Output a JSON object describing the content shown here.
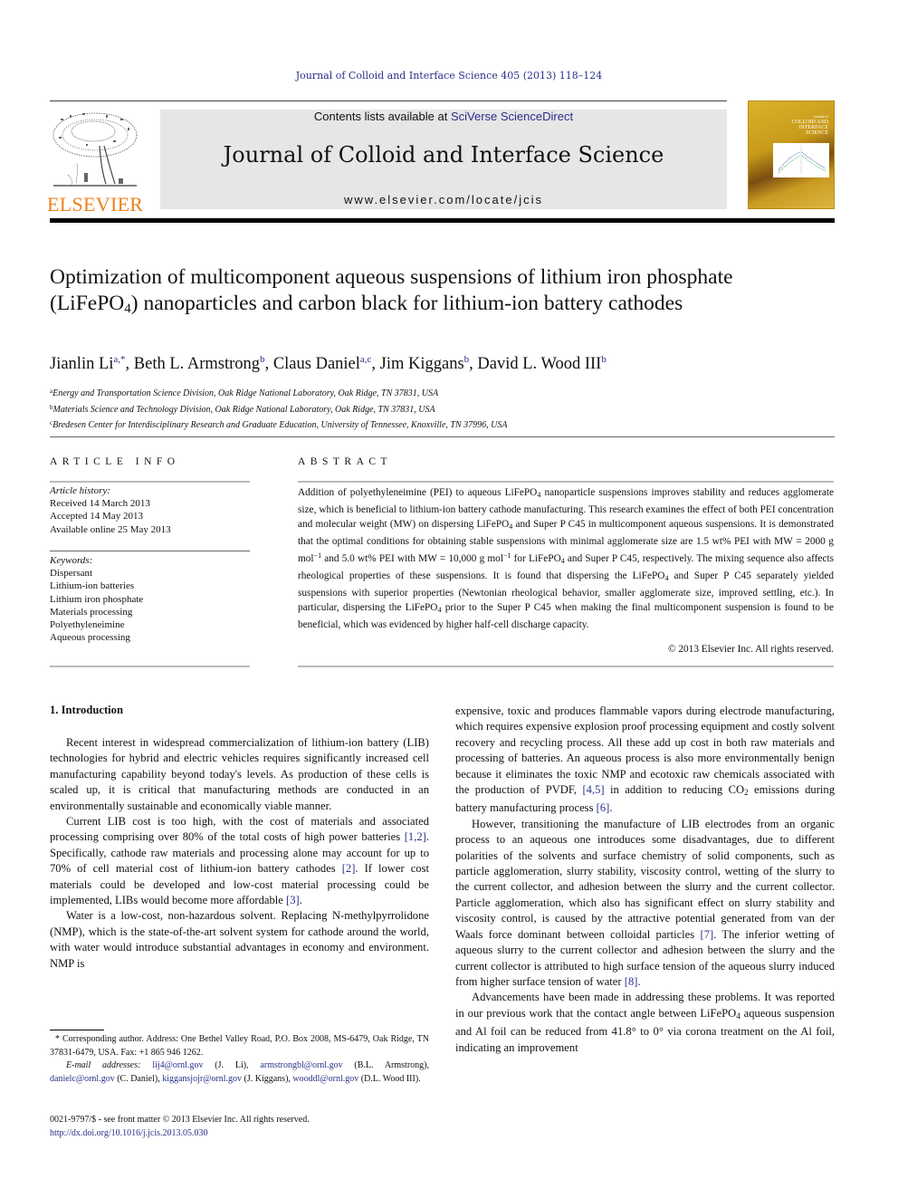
{
  "running_head": "Journal of Colloid and Interface Science 405 (2013) 118–124",
  "publisher": {
    "logo_word": "ELSEVIER",
    "contents_prefix": "Contents lists available at ",
    "contents_link": "SciVerse ScienceDirect",
    "journal_name": "Journal of Colloid and Interface Science",
    "journal_url": "www.elsevier.com/locate/jcis",
    "cover_title_lines": [
      "Journal of",
      "COLLOID AND",
      "INTERFACE",
      "SCIENCE"
    ]
  },
  "colors": {
    "link": "#2a2f8a",
    "elsevier_orange": "#f07f1a",
    "banner_gray": "#e6e6e6",
    "cover_gold": "#c89a1a"
  },
  "article": {
    "title_parts": {
      "before_sub": "Optimization of multicomponent aqueous suspensions of lithium iron phosphate (LiFePO",
      "sub": "4",
      "after_sub": ") nanoparticles and carbon black for lithium-ion battery cathodes"
    },
    "authors": [
      {
        "name": "Jianlin Li",
        "sup": "a,*",
        "sep": ", "
      },
      {
        "name": "Beth L. Armstrong",
        "sup": "b",
        "sep": ", "
      },
      {
        "name": "Claus Daniel",
        "sup": "a,c",
        "sep": ", "
      },
      {
        "name": "Jim Kiggans",
        "sup": "b",
        "sep": ", "
      },
      {
        "name": "David L. Wood III",
        "sup": "b",
        "sep": ""
      }
    ],
    "affiliations": [
      {
        "mark": "a",
        "text": "Energy and Transportation Science Division, Oak Ridge National Laboratory, Oak Ridge, TN 37831, USA"
      },
      {
        "mark": "b",
        "text": "Materials Science and Technology Division, Oak Ridge National Laboratory, Oak Ridge, TN 37831, USA"
      },
      {
        "mark": "c",
        "text": "Bredesen Center for Interdisciplinary Research and Graduate Education, University of Tennessee, Knoxville, TN 37996, USA"
      }
    ]
  },
  "article_info": {
    "heading": "ARTICLE INFO",
    "history_label": "Article history:",
    "history": [
      "Received 14 March 2013",
      "Accepted 14 May 2013",
      "Available online 25 May 2013"
    ],
    "keywords_label": "Keywords:",
    "keywords": [
      "Dispersant",
      "Lithium-ion batteries",
      "Lithium iron phosphate",
      "Materials processing",
      "Polyethyleneimine",
      "Aqueous processing"
    ]
  },
  "abstract": {
    "heading": "ABSTRACT",
    "segments": [
      {
        "t": "Addition of polyethyleneimine (PEI) to aqueous LiFePO"
      },
      {
        "sub": "4"
      },
      {
        "t": " nanoparticle suspensions improves stability and reduces agglomerate size, which is beneficial to lithium-ion battery cathode manufacturing. This research examines the effect of both PEI concentration and molecular weight (MW) on dispersing LiFePO"
      },
      {
        "sub": "4"
      },
      {
        "t": " and Super P C45 in multicomponent aqueous suspensions. It is demonstrated that the optimal conditions for obtaining stable suspensions with minimal agglomerate size are 1.5 wt% PEI with MW = 2000 g mol"
      },
      {
        "sup": "−1"
      },
      {
        "t": " and 5.0 wt% PEI with MW = 10,000 g mol"
      },
      {
        "sup": "−1"
      },
      {
        "t": " for LiFePO"
      },
      {
        "sub": "4"
      },
      {
        "t": " and Super P C45, respectively. The mixing sequence also affects rheological properties of these suspensions. It is found that dispersing the LiFePO"
      },
      {
        "sub": "4"
      },
      {
        "t": " and Super P C45 separately yielded suspensions with superior properties (Newtonian rheological behavior, smaller agglomerate size, improved settling, etc.). In particular, dispersing the LiFePO"
      },
      {
        "sub": "4"
      },
      {
        "t": " prior to the Super P C45 when making the final multicomponent suspension is found to be beneficial, which was evidenced by higher half-cell discharge capacity."
      }
    ],
    "copyright": "© 2013 Elsevier Inc. All rights reserved."
  },
  "body": {
    "section_heading": "1. Introduction",
    "left_paragraphs": [
      [
        {
          "t": "Recent interest in widespread commercialization of lithium-ion battery (LIB) technologies for hybrid and electric vehicles requires significantly increased cell manufacturing capability beyond today's levels. As production of these cells is scaled up, it is critical that manufacturing methods are conducted in an environmentally sustainable and economically viable manner."
        }
      ],
      [
        {
          "t": "Current LIB cost is too high, with the cost of materials and associated processing comprising over 80% of the total costs of high power batteries "
        },
        {
          "ref": "[1,2]"
        },
        {
          "t": ". Specifically, cathode raw materials and processing alone may account for up to 70% of cell material cost of lithium-ion battery cathodes "
        },
        {
          "ref": "[2]"
        },
        {
          "t": ". If lower cost materials could be developed and low-cost material processing could be implemented, LIBs would become more affordable "
        },
        {
          "ref": "[3]"
        },
        {
          "t": "."
        }
      ],
      [
        {
          "t": "Water is a low-cost, non-hazardous solvent. Replacing N-methylpyrrolidone (NMP), which is the state-of-the-art solvent system for cathode around the world, with water would introduce substantial advantages in economy and environment. NMP is"
        }
      ]
    ],
    "right_paragraphs": [
      {
        "indent": false,
        "segs": [
          {
            "t": "expensive, toxic and produces flammable vapors during electrode manufacturing, which requires expensive explosion proof processing equipment and costly solvent recovery and recycling process. All these add up cost in both raw materials and processing of batteries. An aqueous process is also more environmentally benign because it eliminates the toxic NMP and ecotoxic raw chemicals associated with the production of PVDF, "
          },
          {
            "ref": "[4,5]"
          },
          {
            "t": " in addition to reducing CO"
          },
          {
            "sub": "2"
          },
          {
            "t": " emissions during battery manufacturing process "
          },
          {
            "ref": "[6]"
          },
          {
            "t": "."
          }
        ]
      },
      {
        "indent": true,
        "segs": [
          {
            "t": "However, transitioning the manufacture of LIB electrodes from an organic process to an aqueous one introduces some disadvantages, due to different polarities of the solvents and surface chemistry of solid components, such as particle agglomeration, slurry stability, viscosity control, wetting of the slurry to the current collector, and adhesion between the slurry and the current collector. Particle agglomeration, which also has significant effect on slurry stability and viscosity control, is caused by the attractive potential generated from van der Waals force dominant between colloidal particles "
          },
          {
            "ref": "[7]"
          },
          {
            "t": ". The inferior wetting of aqueous slurry to the current collector and adhesion between the slurry and the current collector is attributed to high surface tension of the aqueous slurry induced from higher surface tension of water "
          },
          {
            "ref": "[8]"
          },
          {
            "t": "."
          }
        ]
      },
      {
        "indent": true,
        "segs": [
          {
            "t": "Advancements have been made in addressing these problems. It was reported in our previous work that the contact angle between LiFePO"
          },
          {
            "sub": "4"
          },
          {
            "t": " aqueous suspension and Al foil can be reduced from 41.8° to 0° via corona treatment on the Al foil, indicating an improvement"
          }
        ]
      }
    ]
  },
  "footnotes": {
    "corresponding": "* Corresponding author. Address: One Bethel Valley Road, P.O. Box 2008, MS-6479, Oak Ridge, TN 37831-6479, USA. Fax: +1 865 946 1262.",
    "email_label": "E-mail addresses: ",
    "emails": [
      {
        "addr": "lij4@ornl.gov",
        "who": " (J. Li), "
      },
      {
        "addr": "armstrongbl@ornl.gov",
        "who": " (B.L. Armstrong), "
      },
      {
        "addr": "danielc@ornl.gov",
        "who": " (C. Daniel), "
      },
      {
        "addr": "kiggansjojr@ornl.gov",
        "who": " (J. Kiggans), "
      },
      {
        "addr": "wooddl@ornl.gov",
        "who": " (D.L. Wood III)."
      }
    ],
    "front_matter": "0021-9797/$ - see front matter © 2013 Elsevier Inc. All rights reserved.",
    "doi": "http://dx.doi.org/10.1016/j.jcis.2013.05.030"
  }
}
